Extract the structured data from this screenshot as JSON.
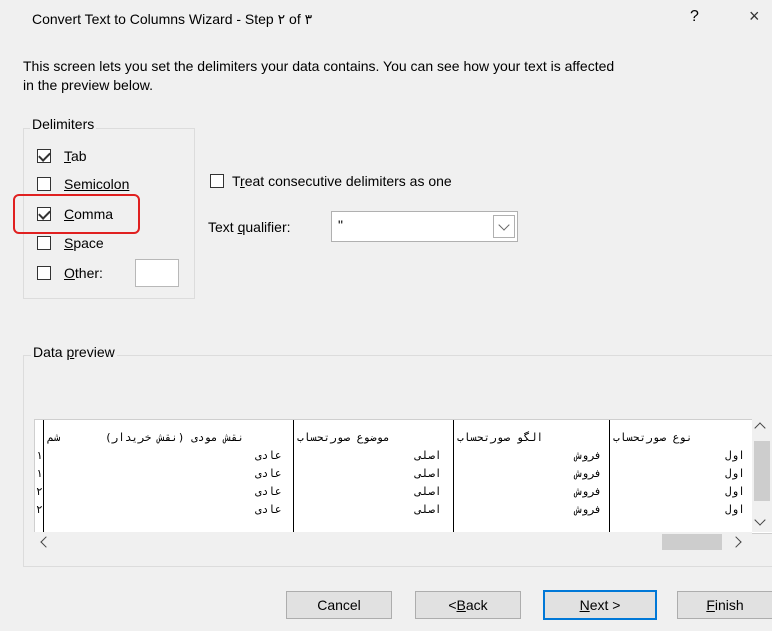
{
  "window": {
    "title": "Convert Text to Columns Wizard - Step ٢ of ٣",
    "help_glyph": "?",
    "close_glyph": "×"
  },
  "description": {
    "line1": "This screen lets you set the delimiters your data contains.  You can see how your text is affected",
    "line2": "in the preview below."
  },
  "delimiters": {
    "group_label": "Delimiters",
    "items": [
      {
        "key": "T",
        "rest": "ab",
        "checked": true
      },
      {
        "key": "",
        "rest": "Semicolon",
        "checked": false
      },
      {
        "key": "C",
        "rest": "omma",
        "checked": true
      },
      {
        "key": "S",
        "rest": "pace",
        "checked": false
      },
      {
        "key": "O",
        "rest": "ther:",
        "checked": false
      }
    ],
    "other_value": ""
  },
  "options": {
    "consecutive_key": "r",
    "consecutive_pre": "T",
    "consecutive_post": "eat consecutive delimiters as one",
    "consecutive_checked": false,
    "qualifier_pre": "Text ",
    "qualifier_key": "q",
    "qualifier_post": "ualifier:",
    "qualifier_value": "\""
  },
  "preview": {
    "group_label_pre": "Data ",
    "group_label_key": "p",
    "group_label_post": "review",
    "header": [
      "نوع صورتحساب",
      "الگو صورتحساب",
      "موضوع صورتحساب",
      "نقش مودی (نقش خریدار)",
      "شم"
    ],
    "rows": [
      [
        "اول",
        "فروش",
        "اصلی",
        "عادی",
        "۱"
      ],
      [
        "اول",
        "فروش",
        "اصلی",
        "عادی",
        "۱"
      ],
      [
        "اول",
        "فروش",
        "اصلی",
        "عادی",
        "۲"
      ],
      [
        "اول",
        "فروش",
        "اصلی",
        "عادی",
        "۲"
      ]
    ]
  },
  "buttons": {
    "cancel": "Cancel",
    "back_pre": "< ",
    "back_key": "B",
    "back_post": "ack",
    "next_key": "N",
    "next_post": "ext >",
    "finish_key": "F",
    "finish_post": "inish"
  },
  "colors": {
    "highlight": "#e02020",
    "default_button_border": "#0078d7"
  }
}
